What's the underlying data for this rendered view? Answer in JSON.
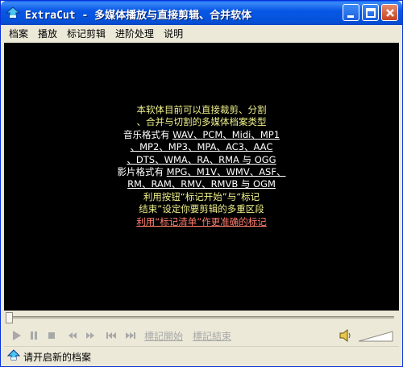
{
  "window": {
    "title": "ExtraCut - 多媒体播放与直接剪辑、合并软体"
  },
  "menu": [
    "档案",
    "播放",
    "标记剪辑",
    "进阶处理",
    "说明"
  ],
  "info": {
    "line1": "本软体目前可以直接裁剪、分割",
    "line2": "、合并与切割的多媒体档案类型",
    "audio_label": "音乐格式有 ",
    "audio_formats_1": "WAV、PCM、Midi、MP1",
    "audio_formats_2": "、MP2、MP3、MPA、AC3、AAC",
    "audio_formats_3": "、DTS、WMA、RA、RMA 与 OGG",
    "video_label": "影片格式有 ",
    "video_formats_1": "MPG、M1V、WMV、ASF、",
    "video_formats_2": "RM、RAM、RMV、RMVB 与 OGM",
    "tip_line1": "利用按钮“标记开始”与“标记",
    "tip_line2": "结束”设定你要剪辑的多重区段",
    "tip_line3": "利用“标记清单”作更准确的标记"
  },
  "controls": {
    "mark_start": "標記開始",
    "mark_end": "標記結束",
    "icons": [
      "play-icon",
      "pause-icon",
      "stop-icon",
      "rewind-icon",
      "fast-forward-icon",
      "skip-back-icon",
      "skip-forward-icon"
    ]
  },
  "status": {
    "text": "请开启新的档案"
  },
  "colors": {
    "title_bar": "#0858e6",
    "video_background": "#000000",
    "info_yellow": "#f0f08c",
    "info_red": "#ff7c6c",
    "disabled_text": "#a8a8a8"
  }
}
